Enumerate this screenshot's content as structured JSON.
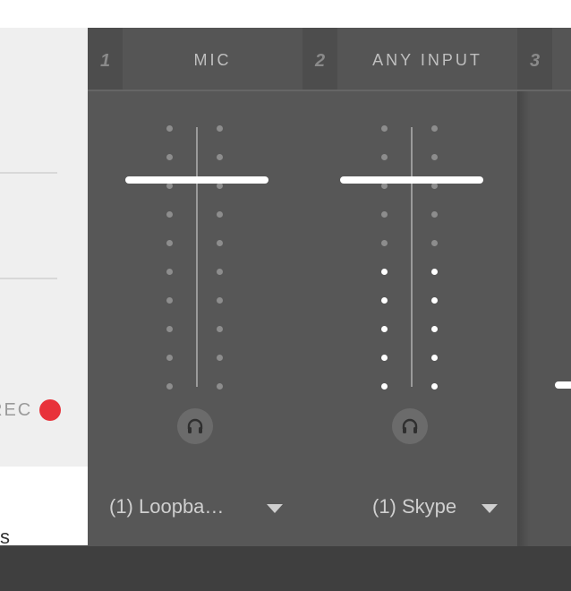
{
  "left_panel": {
    "rec_label": "REC",
    "bottom_label": "s",
    "rec_color": "#e8323a"
  },
  "channels": [
    {
      "number": "1",
      "name": "MIC",
      "input": "(1) Loopba…",
      "lit_dots": 0,
      "total_dots_per_column": 10
    },
    {
      "number": "2",
      "name": "ANY INPUT",
      "input": "(1) Skype",
      "lit_dots": 5,
      "total_dots_per_column": 10
    },
    {
      "number": "3",
      "name": "",
      "input": ""
    }
  ],
  "icons": {
    "headphones": "headphones-icon",
    "dropdown": "chevron-down-icon",
    "record": "record-dot-icon"
  },
  "colors": {
    "accent_white": "#ffffff",
    "meter_dot_inactive": "#8d8d8d",
    "channel_bg": "#555555"
  }
}
